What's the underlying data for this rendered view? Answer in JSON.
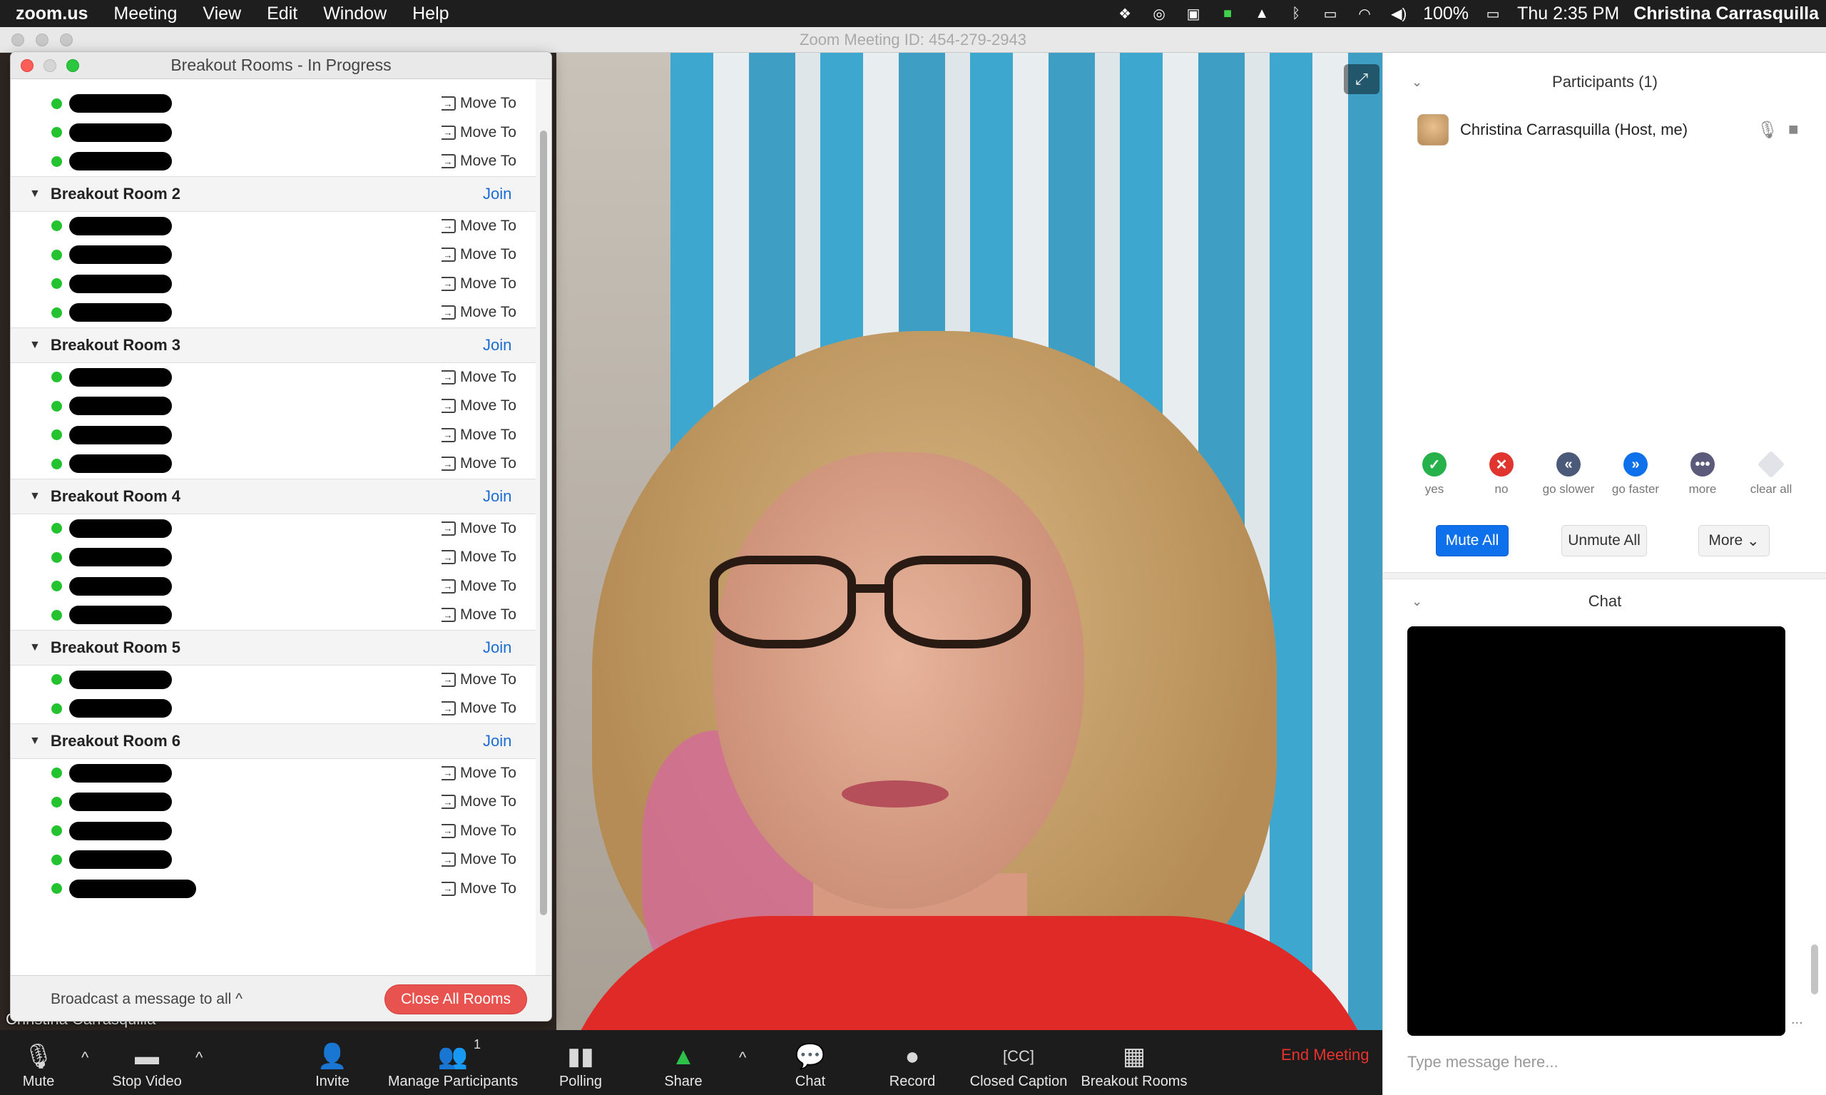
{
  "menubar": {
    "app": "zoom.us",
    "items": [
      "Meeting",
      "View",
      "Edit",
      "Window",
      "Help"
    ],
    "battery": "100%",
    "clock": "Thu 2:35 PM",
    "user": "Christina Carrasquilla"
  },
  "window": {
    "title": "Zoom Meeting ID: 454-279-2943"
  },
  "breakout": {
    "title": "Breakout Rooms - In Progress",
    "move_label": "Move To",
    "join_label": "Join",
    "rooms": [
      {
        "name": "Breakout Room 2"
      },
      {
        "name": "Breakout Room 3"
      },
      {
        "name": "Breakout Room 4"
      },
      {
        "name": "Breakout Room 5"
      },
      {
        "name": "Breakout Room 6"
      }
    ],
    "broadcast_label": "Broadcast a message to all ^",
    "close_all_label": "Close All Rooms"
  },
  "video": {
    "speaker_name": "Christina Carrasquilla"
  },
  "toolbar": {
    "mute": "Mute",
    "stop_video": "Stop Video",
    "invite": "Invite",
    "manage_participants": "Manage Participants",
    "participant_count": "1",
    "polling": "Polling",
    "share": "Share",
    "chat": "Chat",
    "record": "Record",
    "closed_caption": "Closed Caption",
    "breakout_rooms": "Breakout Rooms",
    "end_meeting": "End Meeting"
  },
  "participants": {
    "title": "Participants (1)",
    "list": [
      {
        "name": "Christina Carrasquilla (Host, me)"
      }
    ],
    "reactions": [
      "yes",
      "no",
      "go slower",
      "go faster",
      "more",
      "clear all"
    ],
    "mute_all": "Mute All",
    "unmute_all": "Unmute All",
    "more": "More"
  },
  "chat": {
    "title": "Chat",
    "placeholder": "Type message here..."
  },
  "colors": {
    "accent_blue": "#0e71eb",
    "end_red": "#e8322e",
    "online_green": "#22c32e",
    "close_all_red": "#e8534f"
  }
}
